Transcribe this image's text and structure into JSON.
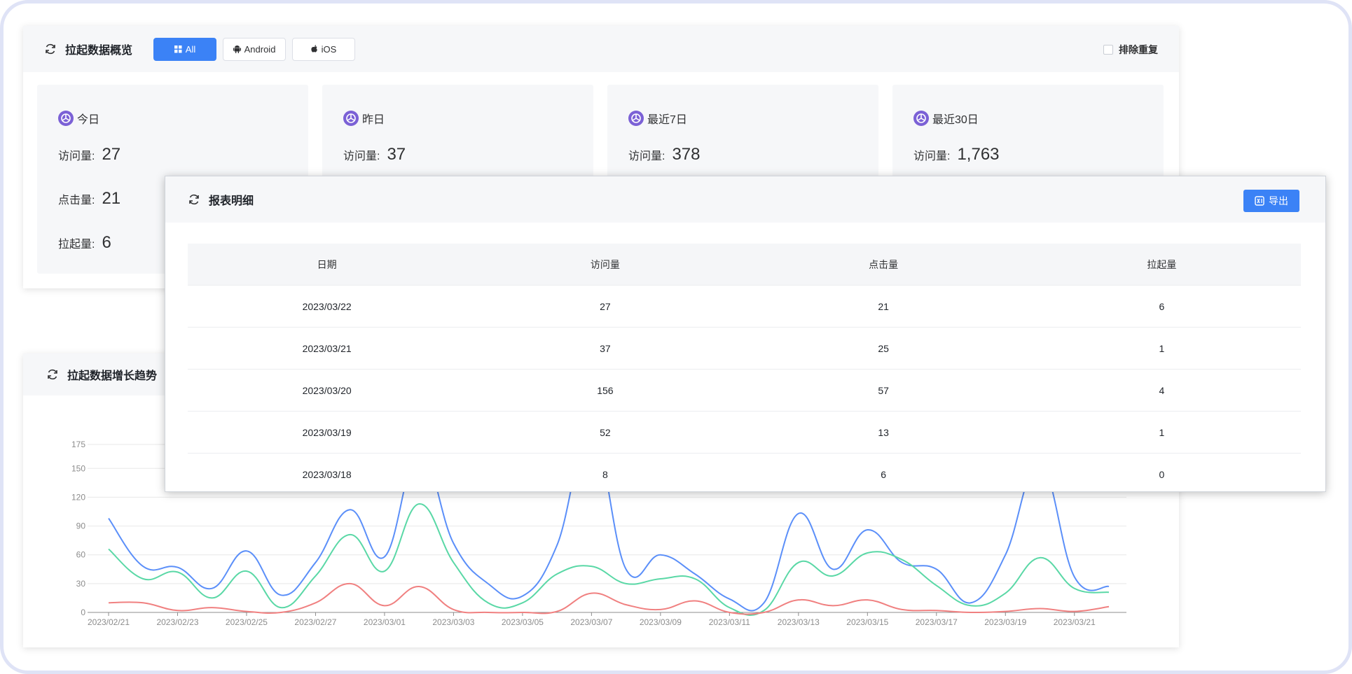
{
  "overview": {
    "title": "拉起数据概览",
    "platforms": [
      {
        "label": "All",
        "icon": "grid-icon",
        "active": true
      },
      {
        "label": "Android",
        "icon": "android-icon",
        "active": false
      },
      {
        "label": "iOS",
        "icon": "apple-icon",
        "active": false
      }
    ],
    "dedupe_label": "排除重复",
    "dedupe_checked": false,
    "visits_label": "访问量:",
    "clicks_label": "点击量:",
    "launches_label": "拉起量:",
    "stats": [
      {
        "title": "今日",
        "visits": "27",
        "clicks": "21",
        "launches": "6"
      },
      {
        "title": "昨日",
        "visits": "37"
      },
      {
        "title": "最近7日",
        "visits": "378"
      },
      {
        "title": "最近30日",
        "visits": "1,763"
      }
    ]
  },
  "report": {
    "title": "报表明细",
    "export_label": "导出",
    "columns": [
      "日期",
      "访问量",
      "点击量",
      "拉起量"
    ],
    "rows": [
      [
        "2023/03/22",
        "27",
        "21",
        "6"
      ],
      [
        "2023/03/21",
        "37",
        "25",
        "1"
      ],
      [
        "2023/03/20",
        "156",
        "57",
        "4"
      ],
      [
        "2023/03/19",
        "52",
        "13",
        "1"
      ],
      [
        "2023/03/18",
        "8",
        "6",
        "0"
      ]
    ]
  },
  "trend": {
    "title": "拉起数据增长趋势"
  },
  "colors": {
    "accent": "#3b82f6",
    "series_visits": "#5b8ff9",
    "series_clicks": "#5ad8a6",
    "series_launches": "#f08080",
    "logo_purple": "#7b61d6"
  },
  "chart_data": {
    "type": "line",
    "x": [
      "2023/02/21",
      "2023/02/22",
      "2023/02/23",
      "2023/02/24",
      "2023/02/25",
      "2023/02/26",
      "2023/02/27",
      "2023/02/28",
      "2023/03/01",
      "2023/03/02",
      "2023/03/03",
      "2023/03/04",
      "2023/03/05",
      "2023/03/06",
      "2023/03/07",
      "2023/03/08",
      "2023/03/09",
      "2023/03/10",
      "2023/03/11",
      "2023/03/12",
      "2023/03/13",
      "2023/03/14",
      "2023/03/15",
      "2023/03/16",
      "2023/03/17",
      "2023/03/18",
      "2023/03/19",
      "2023/03/20",
      "2023/03/21",
      "2023/03/22"
    ],
    "xtick_labels": [
      "2023/02/21",
      "2023/02/23",
      "2023/02/25",
      "2023/02/27",
      "2023/03/01",
      "2023/03/03",
      "2023/03/05",
      "2023/03/07",
      "2023/03/09",
      "2023/03/11",
      "2023/03/13",
      "2023/03/15",
      "2023/03/17",
      "2023/03/19",
      "2023/03/21"
    ],
    "yticks": [
      0,
      30,
      60,
      90,
      120,
      150,
      175
    ],
    "ylim": [
      0,
      175
    ],
    "grid": true,
    "series": [
      {
        "values": [
          98,
          48,
          47,
          25,
          64,
          18,
          52,
          107,
          58,
          168,
          72,
          30,
          17,
          70,
          190,
          45,
          60,
          40,
          14,
          10,
          103,
          45,
          86,
          52,
          45,
          10,
          60,
          156,
          37,
          27
        ]
      },
      {
        "values": [
          66,
          35,
          42,
          15,
          43,
          5,
          38,
          81,
          43,
          113,
          52,
          10,
          10,
          40,
          48,
          30,
          35,
          35,
          5,
          2,
          52,
          38,
          62,
          55,
          28,
          7,
          20,
          57,
          25,
          21
        ]
      },
      {
        "values": [
          10,
          10,
          2,
          5,
          1,
          0,
          10,
          30,
          7,
          27,
          3,
          0,
          0,
          1,
          20,
          8,
          3,
          12,
          0,
          0,
          13,
          7,
          13,
          3,
          2,
          0,
          1,
          4,
          1,
          6
        ]
      }
    ]
  }
}
